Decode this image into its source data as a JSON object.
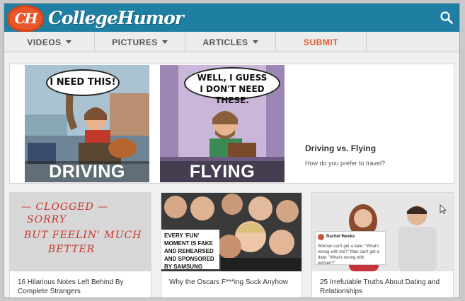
{
  "header": {
    "logo_mark": "CH",
    "logo_text": "CollegeHumor",
    "icons": {
      "search": "search-icon"
    },
    "brand_color": "#1f7fa2",
    "accent_color": "#e05a2b"
  },
  "nav": {
    "items": [
      {
        "label": "VIDEOS",
        "dropdown": true
      },
      {
        "label": "PICTURES",
        "dropdown": true
      },
      {
        "label": "ARTICLES",
        "dropdown": true
      },
      {
        "label": "SUBMIT",
        "dropdown": false
      }
    ]
  },
  "featured": {
    "title": "Driving vs. Flying",
    "subtitle": "How do you prefer to travel?",
    "panels": [
      {
        "caption": "DRIVING",
        "bubble": "I NEED THIS!"
      },
      {
        "caption": "FLYING",
        "bubble_line1": "WELL, I GUESS",
        "bubble_line2": "I DON'T NEED THESE."
      }
    ]
  },
  "cards": [
    {
      "title": "16 Hilarious Notes Left Behind By Complete Strangers",
      "note_lines": [
        "— CLOGGED —",
        "SORRY",
        "BUT FEELIN' MUCH",
        "BETTER"
      ]
    },
    {
      "title": "Why the Oscars F***ing Suck Anyhow",
      "image_caption": "EVERY 'FUN' MOMENT IS FAKE AND REHEARSED AND SPONSORED BY SAMSUNG"
    },
    {
      "title": "25 Irrefutable Truths About Dating and Relationships",
      "tweet_name": "Rachel Weeks",
      "tweet_text": "Woman can't get a date: \"What's wrong with me?\" Man can't get a date: \"What's wrong with women?\""
    }
  ]
}
